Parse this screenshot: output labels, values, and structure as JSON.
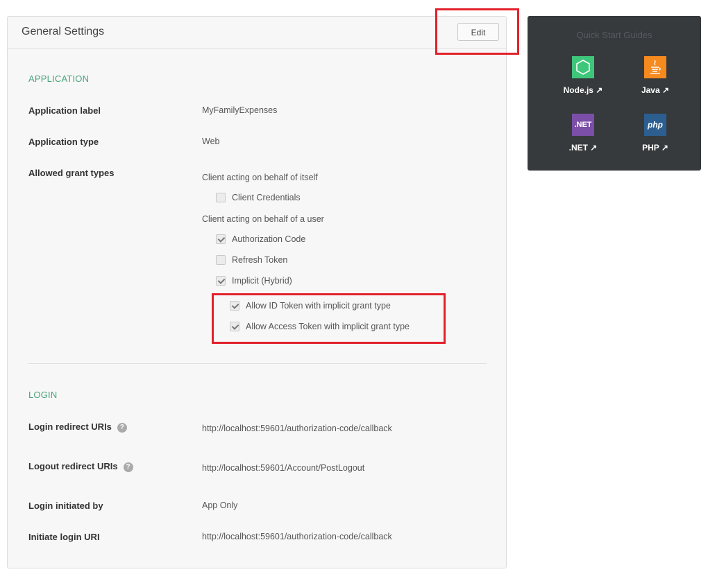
{
  "panel": {
    "title": "General Settings",
    "edit_label": "Edit"
  },
  "application": {
    "section_title": "APPLICATION",
    "label_label": "Application label",
    "label_value": "MyFamilyExpenses",
    "type_label": "Application type",
    "type_value": "Web",
    "grant_label": "Allowed grant types",
    "client_self": "Client acting on behalf of itself",
    "client_credentials": {
      "label": "Client Credentials",
      "checked": false
    },
    "client_user": "Client acting on behalf of a user",
    "authorization_code": {
      "label": "Authorization Code",
      "checked": true
    },
    "refresh_token": {
      "label": "Refresh Token",
      "checked": false
    },
    "implicit": {
      "label": "Implicit (Hybrid)",
      "checked": true
    },
    "allow_id_token": {
      "label": "Allow ID Token with implicit grant type",
      "checked": true
    },
    "allow_access_token": {
      "label": "Allow Access Token with implicit grant type",
      "checked": true
    }
  },
  "login": {
    "section_title": "LOGIN",
    "redirect_label": "Login redirect URIs",
    "redirect_value": "http://localhost:59601/authorization-code/callback",
    "logout_label": "Logout redirect URIs",
    "logout_value": "http://localhost:59601/Account/PostLogout",
    "initiated_label": "Login initiated by",
    "initiated_value": "App Only",
    "initiate_uri_label": "Initiate login URI",
    "initiate_uri_value": "http://localhost:59601/authorization-code/callback",
    "help_glyph": "?"
  },
  "quick_start": {
    "title": "Quick Start Guides",
    "items": [
      {
        "label": "Node.js ↗",
        "icon": "nodejs-icon",
        "color": "#3ec77a"
      },
      {
        "label": "Java ↗",
        "icon": "java-icon",
        "color": "#f58a1f"
      },
      {
        "label": ".NET ↗",
        "icon": "dotnet-icon",
        "color": "#7b4ea8",
        "icon_text": ".NET"
      },
      {
        "label": "PHP ↗",
        "icon": "php-icon",
        "color": "#2c5f90",
        "icon_text": "php"
      }
    ]
  },
  "colors": {
    "section_accent": "#4aa37a",
    "highlight": "#e3202a",
    "quick_start_bg": "#363a3c"
  }
}
